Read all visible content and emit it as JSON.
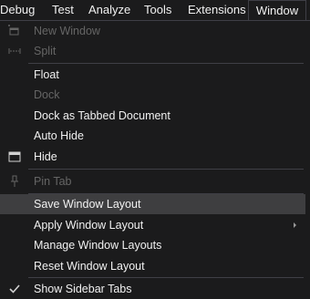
{
  "menubar": {
    "items": [
      {
        "label": "Debug"
      },
      {
        "label": "Test"
      },
      {
        "label": "Analyze"
      },
      {
        "label": "Tools"
      },
      {
        "label": "Extensions"
      },
      {
        "label": "Window"
      }
    ]
  },
  "window_menu": {
    "new_window": "New Window",
    "split": "Split",
    "float": "Float",
    "dock": "Dock",
    "dock_tabbed": "Dock as Tabbed Document",
    "auto_hide": "Auto Hide",
    "hide": "Hide",
    "pin_tab": "Pin Tab",
    "save_layout": "Save Window Layout",
    "apply_layout": "Apply Window Layout",
    "manage_layouts": "Manage Window Layouts",
    "reset_layout": "Reset Window Layout",
    "show_sidebar_tabs": "Show Sidebar Tabs"
  },
  "icons": {
    "new_window": "new-window-icon",
    "split": "split-icon",
    "hide": "hide-window-icon",
    "pin": "pin-icon",
    "check": "checkmark-icon",
    "submenu": "submenu-arrow-icon"
  },
  "colors": {
    "background": "#1b1b1c",
    "hover": "#3e3e40",
    "border": "#3f3f46",
    "text": "#f1f1f1",
    "disabled_text": "#656565"
  }
}
